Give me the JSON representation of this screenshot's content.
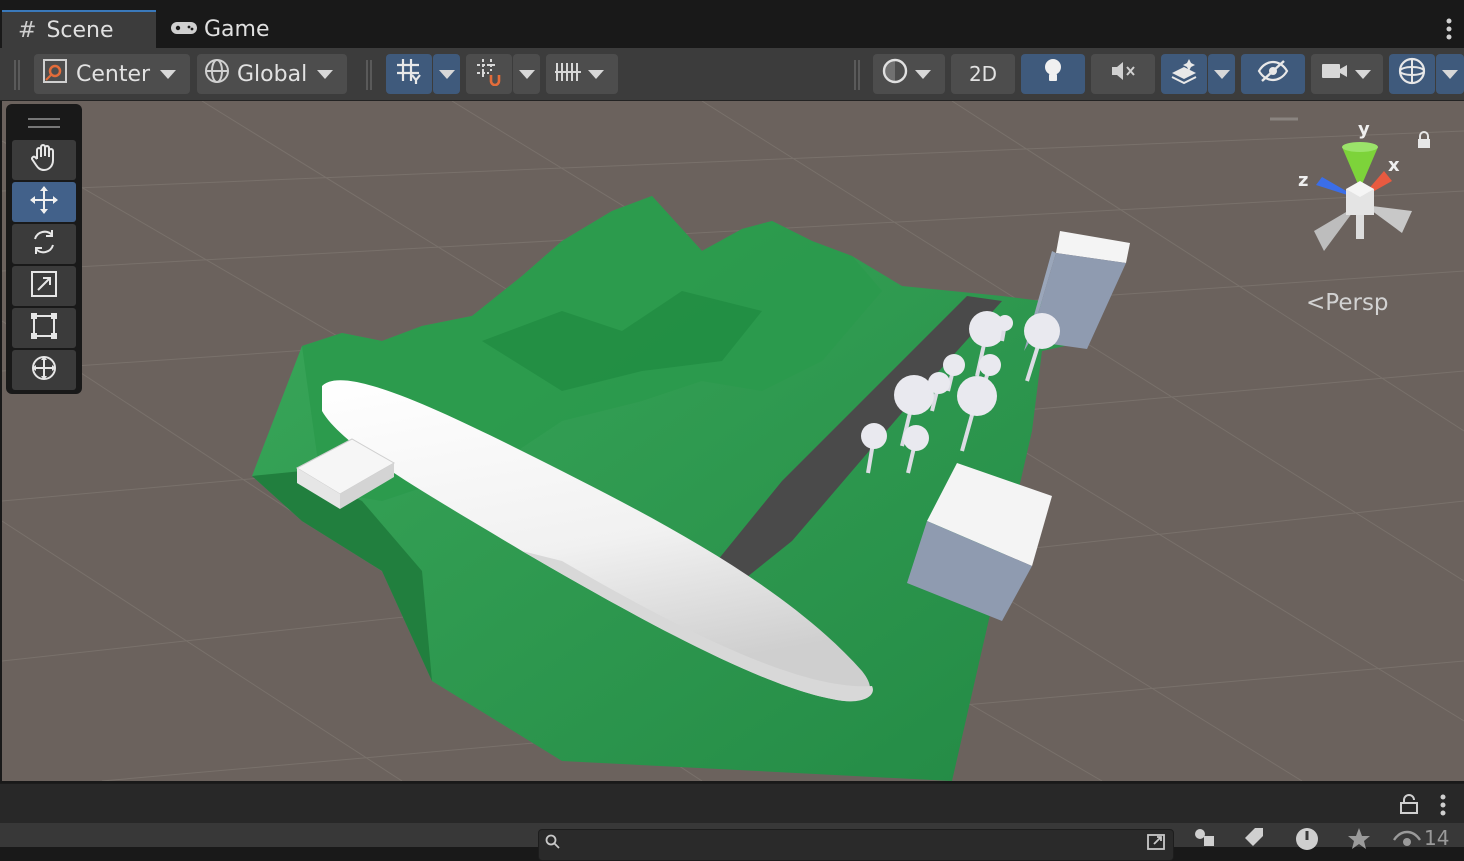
{
  "tabs": [
    {
      "label": "Scene",
      "icon": "hash-icon",
      "active": true
    },
    {
      "label": "Game",
      "icon": "gamepad-icon",
      "active": false
    }
  ],
  "toolbar": {
    "pivot_label": "Center",
    "space_label": "Global",
    "mode_2d_label": "2D"
  },
  "tools": [
    "hand-tool",
    "move-tool",
    "rotate-tool",
    "scale-tool",
    "rect-tool",
    "transform-tool"
  ],
  "active_tool": "move-tool",
  "gizmo": {
    "y": "y",
    "x": "x",
    "z": "z",
    "projection": "Persp"
  },
  "bottom": {
    "visibility_count": "14"
  },
  "colors": {
    "accent": "#3a79bb",
    "active_button": "#3f5a7c",
    "viewport_bg": "#6b625d",
    "terrain": "#2e9650",
    "road": "#4a4a4a"
  }
}
